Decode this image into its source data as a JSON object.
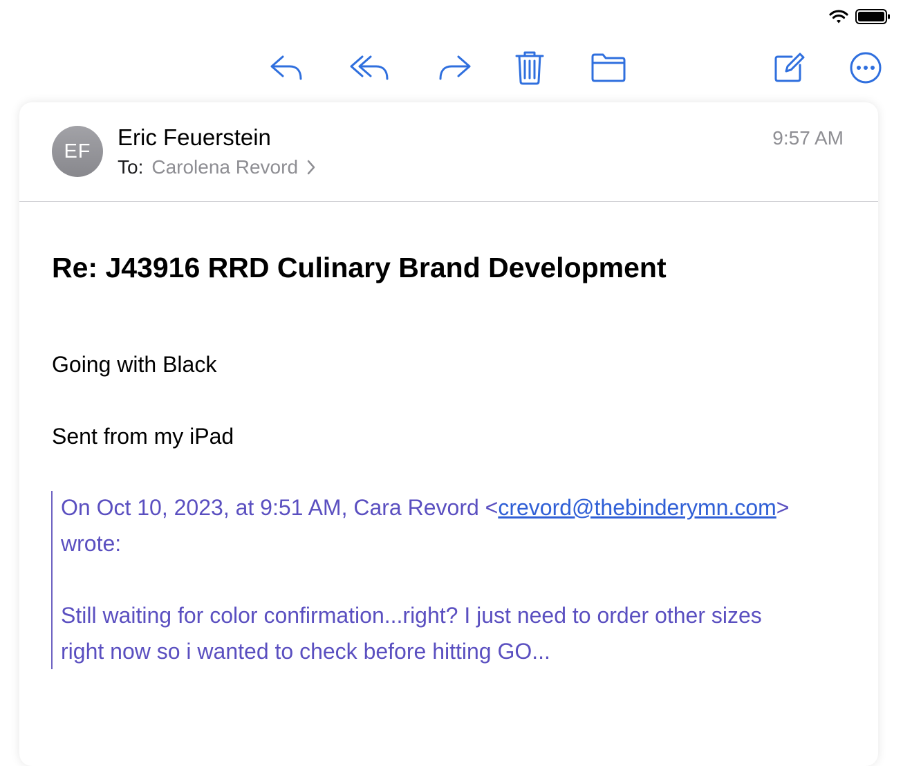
{
  "toolbar": {
    "icons": [
      "reply-icon",
      "reply-all-icon",
      "forward-icon",
      "trash-icon",
      "folder-icon",
      "compose-icon",
      "more-icon"
    ]
  },
  "colors": {
    "accent": "#2f6fde",
    "quote_text": "#5a4fc0",
    "quote_bar": "#6e62c2",
    "secondary_text": "#8e8e93"
  },
  "email": {
    "avatar_initials": "EF",
    "sender": "Eric Feuerstein",
    "to_label": "To:",
    "recipient": "Carolena Revord",
    "time": "9:57 AM",
    "subject": "Re: J43916 RRD Culinary Brand Development",
    "body": [
      "Going with Black",
      "Sent from my iPad"
    ],
    "quote": {
      "intro_prefix": "On Oct 10, 2023, at 9:51 AM, Cara Revord <",
      "email_link": "crevord@thebinderymn.com",
      "intro_suffix": ">",
      "wrote": "wrote:",
      "text_line1": "Still waiting for color confirmation...right? I just need to order other sizes",
      "text_line2": "right now so i wanted to check before hitting GO..."
    }
  }
}
